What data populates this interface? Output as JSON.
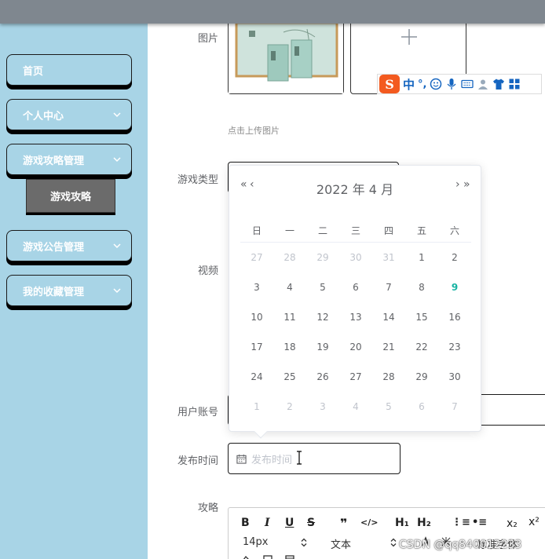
{
  "sidebar": {
    "items": [
      {
        "label": "首页",
        "has_chevron": false
      },
      {
        "label": "个人中心",
        "has_chevron": true
      },
      {
        "label": "游戏攻略管理",
        "has_chevron": true
      },
      {
        "label": "游戏公告管理",
        "has_chevron": true
      },
      {
        "label": "我的收藏管理",
        "has_chevron": true
      }
    ],
    "sub_item": {
      "label": "游戏攻略"
    }
  },
  "form": {
    "image_label": "图片",
    "upload_tip": "点击上传图片",
    "game_type_label": "游戏类型",
    "video_label": "视频",
    "user_account_label": "用户账号",
    "publish_time_label": "发布时间",
    "publish_time_placeholder": "发布时间",
    "strategy_label": "攻略"
  },
  "ime": {
    "logo": "S",
    "mode": "中",
    "punct": "°,"
  },
  "datepicker": {
    "year_month": "2022 年  4 月",
    "prev_year": "«",
    "prev_month": "‹",
    "next_month": "›",
    "next_year": "»",
    "weekdays": [
      "日",
      "一",
      "二",
      "三",
      "四",
      "五",
      "六"
    ],
    "weeks": [
      [
        "27",
        "28",
        "29",
        "30",
        "31",
        "1",
        "2"
      ],
      [
        "3",
        "4",
        "5",
        "6",
        "7",
        "8",
        "9"
      ],
      [
        "10",
        "11",
        "12",
        "13",
        "14",
        "15",
        "16"
      ],
      [
        "17",
        "18",
        "19",
        "20",
        "21",
        "22",
        "23"
      ],
      [
        "24",
        "25",
        "26",
        "27",
        "28",
        "29",
        "30"
      ],
      [
        "1",
        "2",
        "3",
        "4",
        "5",
        "6",
        "7"
      ]
    ],
    "today": "9",
    "today_color": "#17b3a3"
  },
  "editor": {
    "bold": "B",
    "italic": "I",
    "underline": "U",
    "strike": "S",
    "quote": "❞",
    "code": "</>",
    "h1": "H₁",
    "h2": "H₂",
    "ordered_list": "⋮≡",
    "bullet_list": "•≡",
    "subscript": "x₂",
    "superscript": "x²",
    "font_size": "14px",
    "text_style": "文本",
    "font_family": "标准字体"
  },
  "watermark": "CSDN @qq840012233"
}
